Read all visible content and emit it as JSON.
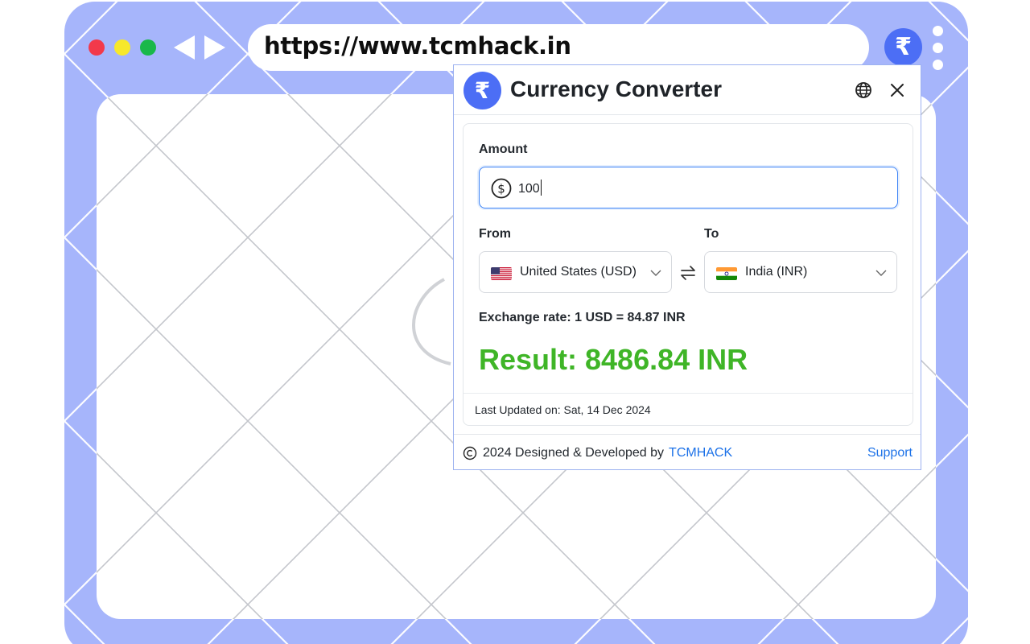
{
  "browser": {
    "url": "https://www.tcmhack.in",
    "extension_icon_glyph": "₹",
    "window_controls": [
      "close",
      "minimize",
      "maximize"
    ],
    "colors": {
      "frame": "#a6b5fb",
      "close": "#f2394b",
      "minimize": "#f7e82b",
      "maximize": "#19b84a"
    }
  },
  "popup": {
    "brand_glyph": "₹",
    "title": "Currency Converter",
    "icons": {
      "language": "globe-icon",
      "close": "close-icon"
    },
    "amount": {
      "label": "Amount",
      "currency_icon": "dollar-circle-icon",
      "value": "100"
    },
    "from": {
      "label": "From",
      "selected": "United States (USD)",
      "flag": "us-flag-icon"
    },
    "to": {
      "label": "To",
      "selected": "India (INR)",
      "flag": "india-flag-icon"
    },
    "swap_icon": "swap-arrows-icon",
    "exchange_rate": "Exchange rate: 1 USD = 84.87 INR",
    "result": "Result: 8486.84 INR",
    "last_updated": "Last Updated on: Sat, 14 Dec 2024",
    "footer": {
      "credits": "2024 Designed & Developed by",
      "brand_link": "TCMHACK",
      "support_link": "Support"
    },
    "colors": {
      "accent": "#4c6ef5",
      "result": "#3fb527",
      "link": "#1d72e8"
    }
  }
}
